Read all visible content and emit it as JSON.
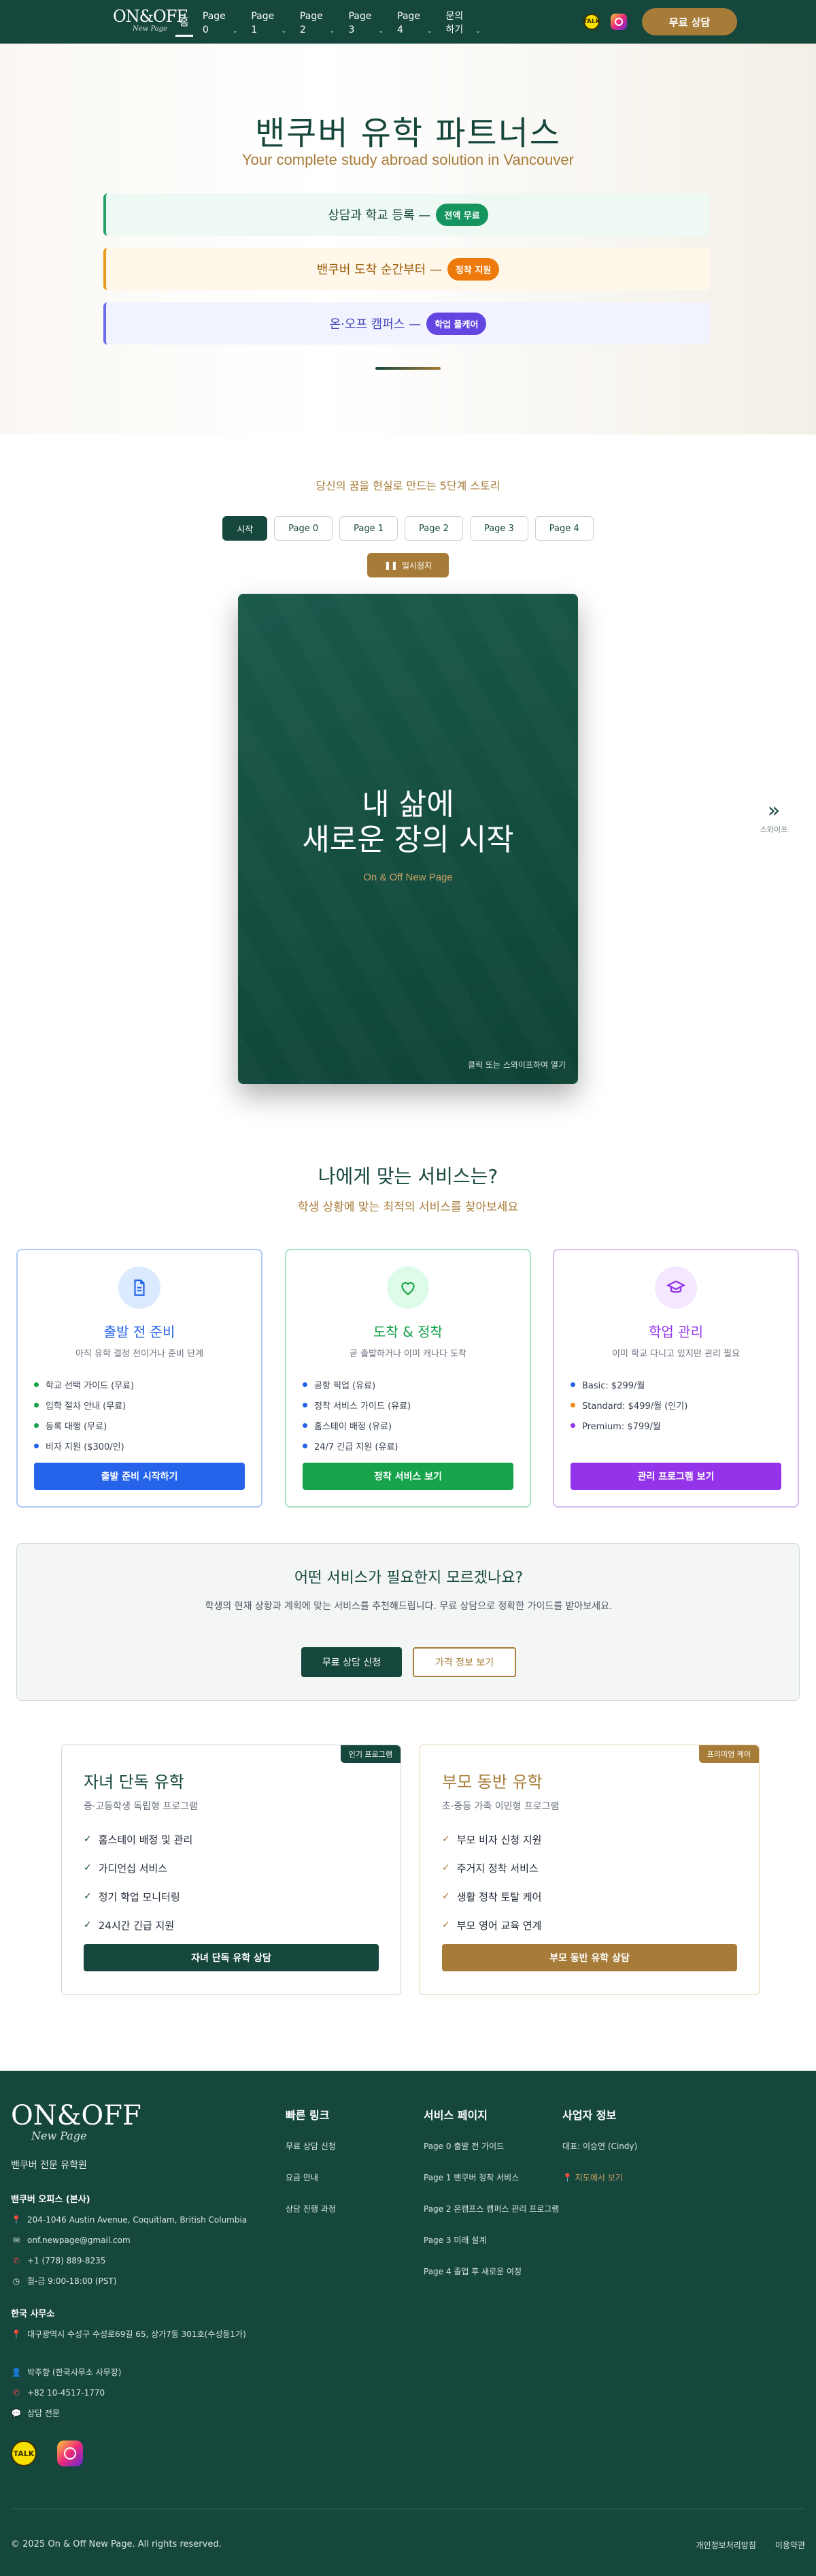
{
  "header": {
    "logo_main": "ON&OFF",
    "logo_sub": "New Page",
    "nav": [
      {
        "label": "홈",
        "has_dropdown": false
      },
      {
        "label": "Page\n0",
        "has_dropdown": true
      },
      {
        "label": "Page\n1",
        "has_dropdown": true
      },
      {
        "label": "Page\n2",
        "has_dropdown": true
      },
      {
        "label": "Page\n3",
        "has_dropdown": true
      },
      {
        "label": "Page\n4",
        "has_dropdown": true
      },
      {
        "label": "문의\n하기",
        "has_dropdown": true
      }
    ],
    "cta": "무료 상담"
  },
  "hero": {
    "title": "밴쿠버 유학 파트너스",
    "subtitle": "Your complete study abroad solution in Vancouver",
    "boxes": [
      {
        "text": "상담과 학교 등록 —",
        "pill": "전액 무료"
      },
      {
        "text": "밴쿠버 도착 순간부터 —",
        "pill": "정착 지원"
      },
      {
        "text": "온·오프 캠퍼스 —",
        "pill": "학업 풀케어"
      }
    ]
  },
  "story": {
    "subtitle": "당신의 꿈을 현실로 만드는 5단계 스토리",
    "pages": [
      "시작",
      "Page 0",
      "Page 1",
      "Page 2",
      "Page 3",
      "Page 4"
    ],
    "pause": "일시정지",
    "slide_title_1": "내 삶에",
    "slide_title_2": "새로운 장의 시작",
    "slide_brand": "On & Off New Page",
    "slide_hint": "클릭 또는 스와이프하여 열기",
    "swipe": "스와이프"
  },
  "services": {
    "title": "나에게 맞는 서비스는?",
    "subtitle": "학생 상황에 맞는 최적의 서비스를 찾아보세요",
    "cards": [
      {
        "title": "출발 전 준비",
        "desc": "아직 유학 결정 전이거나 준비 단계",
        "items": [
          "학교 선택 가이드 (무료)",
          "입학 절차 안내 (무료)",
          "등록 대행 (무료)",
          "비자 지원 ($300/인)"
        ],
        "button": "출발 준비 시작하기",
        "color": "#2563eb"
      },
      {
        "title": "도착 & 정착",
        "desc": "곧 출발하거나 이미 캐나다 도착",
        "items": [
          "공항 픽업 (유료)",
          "정착 서비스 가이드 (유료)",
          "홈스테이 배정 (유료)",
          "24/7 긴급 지원 (유료)"
        ],
        "button": "정착 서비스 보기",
        "color": "#16a34a"
      },
      {
        "title": "학업 관리",
        "desc": "이미 학교 다니고 있지만 관리 필요",
        "items": [
          "Basic: $299/월",
          "Standard: $499/월 (인기)",
          "Premium: $799/월"
        ],
        "button": "관리 프로그램 보기",
        "color": "#9333ea"
      }
    ],
    "unsure": {
      "title": "어떤 서비스가 필요한지 모르겠나요?",
      "desc": "학생의 현재 상황과 계획에 맞는 서비스를 추천해드립니다. 무료 상담으로 정확한 가이드를 받아보세요.",
      "primary": "무료 상담 신청",
      "secondary": "가격 정보 보기"
    }
  },
  "programs": [
    {
      "tag": "인기 프로그램",
      "title": "자녀 단독 유학",
      "desc": "중·고등학생 독립형 프로그램",
      "items": [
        "홈스테이 배정 및 관리",
        "가디언십 서비스",
        "정기 학업 모니터링",
        "24시간 긴급 지원"
      ],
      "button": "자녀 단독 유학 상담"
    },
    {
      "tag": "프리미엄 케어",
      "title": "부모 동반 유학",
      "desc": "초·중등 가족 이민형 프로그램",
      "items": [
        "부모 비자 신청 지원",
        "주거지 정착 서비스",
        "생활 정착 토탈 케어",
        "부모 영어 교육 연계"
      ],
      "button": "부모 동반 유학 상담"
    }
  ],
  "footer": {
    "logo_main": "ON&OFF",
    "logo_sub": "New Page",
    "tagline": "밴쿠버 전문 유학원",
    "vancouver_heading": "밴쿠버 오피스 (본사)",
    "vancouver": [
      {
        "icon": "pin",
        "text": "204-1046 Austin Avenue, Coquitlam, British Columbia"
      },
      {
        "icon": "mail",
        "text": "onf.newpage@gmail.com"
      },
      {
        "icon": "phone",
        "text": "+1 (778) 889-8235"
      },
      {
        "icon": "clock",
        "text": "월-금 9:00-18:00 (PST)"
      }
    ],
    "korea_heading": "한국 사무소",
    "korea": [
      {
        "icon": "pin",
        "text": "대구광역시 수성구 수성로69길 65, 상가7동 301호(수성동1가)"
      },
      {
        "icon": "person",
        "text": "박주향 (한국사무소 사무장)"
      },
      {
        "icon": "phone",
        "text": "+82 10-4517-1770"
      },
      {
        "icon": "chat",
        "text": "상담 전문"
      }
    ],
    "quick_heading": "빠른 링크",
    "quick": [
      "무료 상담 신청",
      "요금 안내",
      "상담 진행 과정"
    ],
    "services_heading": "서비스 페이지",
    "services": [
      "Page 0 출발 전 가이드",
      "Page 1 밴쿠버 정착 서비스",
      "Page 2 온캠프스 캠퍼스 관리 프로그램",
      "Page 3 미래 설계",
      "Page 4 졸업 후 새로운 여정"
    ],
    "biz_heading": "사업자 정보",
    "biz_ceo": "대표: 이승연 (Cindy)",
    "biz_map": "지도에서 보기",
    "copyright": "© 2025 On & Off New Page. All rights reserved.",
    "privacy": "개인정보처리방침",
    "terms": "이용약관"
  },
  "colors": {
    "brand_green": "#16473d",
    "brand_gold": "#a77c39"
  }
}
